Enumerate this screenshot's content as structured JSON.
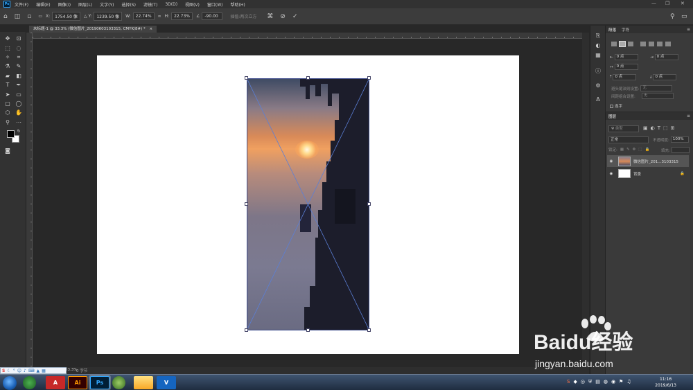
{
  "menubar": {
    "logo": "Ps",
    "items": [
      "文件(F)",
      "编辑(E)",
      "图像(I)",
      "图层(L)",
      "文字(Y)",
      "选择(S)",
      "滤镜(T)",
      "3D(D)",
      "视图(V)",
      "窗口(W)",
      "帮助(H)"
    ]
  },
  "options": {
    "x_label": "X:",
    "x_value": "1754.50 像",
    "y_label": "Y:",
    "y_value": "1239.50 像",
    "w_label": "W:",
    "w_value": "22.74%",
    "h_label": "H:",
    "h_value": "22.73%",
    "angle_value": "-90.00",
    "interp_label": "插值:两次立方"
  },
  "document": {
    "tab_title": "未标题-1 @ 33.3% (微信图片_20190603103315, CMYK/8#) *",
    "status": "33.3%",
    "doc_info": "0 字节"
  },
  "character_panel": {
    "tab1": "段落",
    "tab2": "字符",
    "indent_left": "0 点",
    "indent_right": "0 点",
    "indent_first": "0 点",
    "space_before": "0 点",
    "space_after": "0 点",
    "avoid_label": "避头尾法则设置:",
    "avoid_value": "无",
    "spacing_label": "间距组合设置:",
    "spacing_value": "无",
    "hyphen_label": "连字"
  },
  "layers_panel": {
    "title": "图层",
    "search_placeholder": "类型",
    "blend_mode": "正常",
    "opacity_label": "不透明度:",
    "opacity_value": "100%",
    "lock_label": "锁定:",
    "fill_label": "填充:",
    "layers": [
      {
        "name": "微信图片_201...3103315"
      },
      {
        "name": "背景"
      }
    ]
  },
  "taskbar": {
    "time": "11:16",
    "date": "2019/6/13",
    "apps": [
      "Ai",
      "Ps"
    ]
  },
  "watermark": {
    "line1": "Baidu经验",
    "line2": "jingyan.baidu.com"
  },
  "colors": {
    "canvas_bg": "#282828",
    "panel_bg": "#3a3a3a",
    "ps_accent": "#31a8ff",
    "ai_accent": "#ff9a00"
  }
}
